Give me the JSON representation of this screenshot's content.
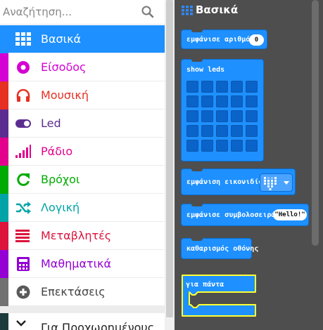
{
  "search": {
    "placeholder": "Αναζήτηση..."
  },
  "categories": [
    {
      "label": "Βασικά",
      "color": "#1e90ff",
      "icon": "grid-icon",
      "selected": true
    },
    {
      "label": "Είσοδος",
      "color": "#d400d4",
      "icon": "radio-button-icon"
    },
    {
      "label": "Μουσική",
      "color": "#e63022",
      "icon": "headphones-icon"
    },
    {
      "label": "Led",
      "color": "#5c2d91",
      "icon": "toggle-icon"
    },
    {
      "label": "Ράδιο",
      "color": "#e3008c",
      "icon": "signal-bars-icon"
    },
    {
      "label": "Βρόχοι",
      "color": "#00aa00",
      "icon": "refresh-icon"
    },
    {
      "label": "Λογική",
      "color": "#00a4a6",
      "icon": "shuffle-icon"
    },
    {
      "label": "Μεταβλητές",
      "color": "#dc143c",
      "icon": "list-lines-icon"
    },
    {
      "label": "Μαθηματικά",
      "color": "#9400d3",
      "icon": "calculator-icon"
    },
    {
      "label": "Επεκτάσεις",
      "color": "#717171",
      "icon": "plus-circle-icon"
    }
  ],
  "advanced": {
    "label": "Για Προχωρημένους",
    "color": "#1b3c3c"
  },
  "flyout": {
    "title": "Βασικά",
    "blocks": {
      "show_number": {
        "label": "εμφάνισε αριθμό",
        "value": "0"
      },
      "show_leds": {
        "label": "show leds"
      },
      "show_icon": {
        "label": "εμφάνιση εικονιδίου"
      },
      "show_string": {
        "label": "εμφάνισε συμβολοσειρά",
        "value": "\"Hello!\""
      },
      "clear_screen": {
        "label": "καθαρισμός οθόνης"
      },
      "forever": {
        "label": "για πάντα"
      }
    }
  }
}
